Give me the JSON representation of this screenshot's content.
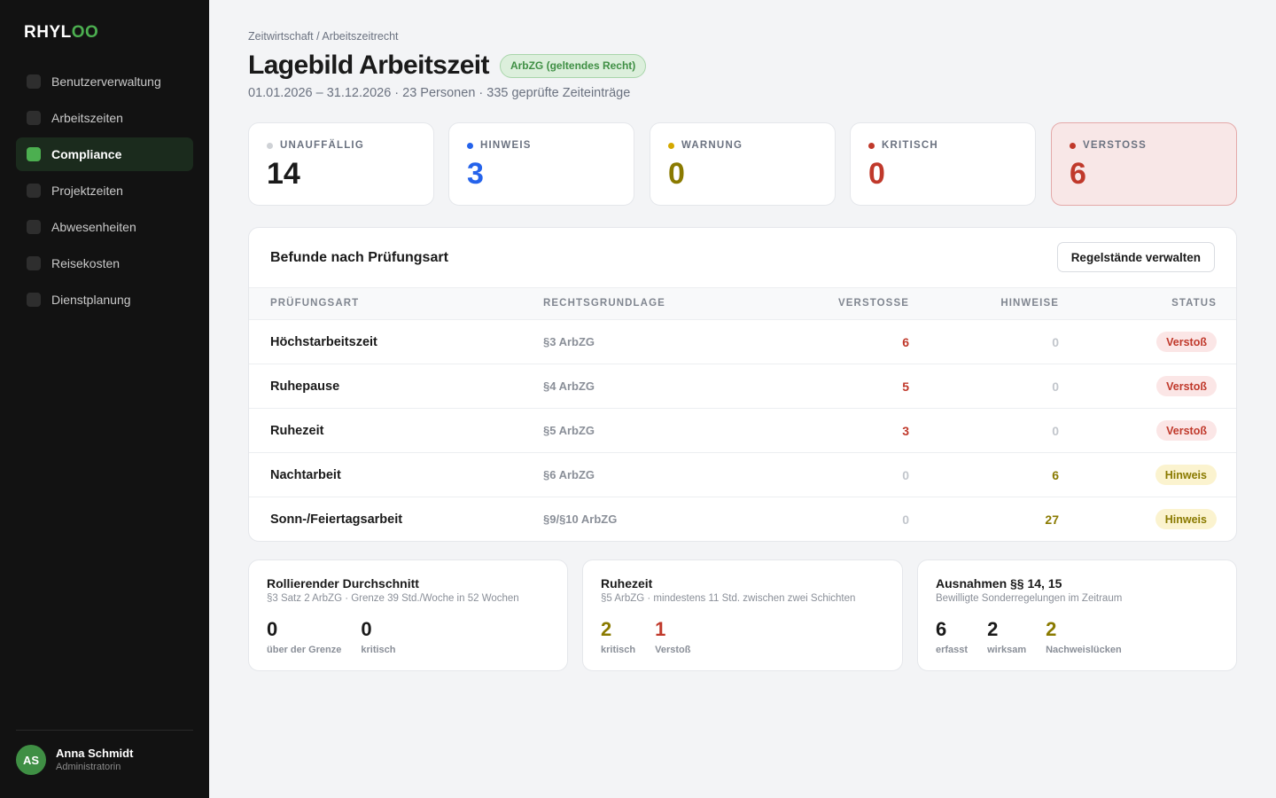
{
  "brand": {
    "logo_main": "RHYL",
    "logo_accent": "OO"
  },
  "sidebar": {
    "items": [
      {
        "label": "Benutzerverwaltung",
        "active": false
      },
      {
        "label": "Arbeitszeiten",
        "active": false
      },
      {
        "label": "Compliance",
        "active": true
      },
      {
        "label": "Projektzeiten",
        "active": false
      },
      {
        "label": "Abwesenheiten",
        "active": false
      },
      {
        "label": "Reisekosten",
        "active": false
      },
      {
        "label": "Dienstplanung",
        "active": false
      }
    ],
    "user": {
      "initials": "AS",
      "name": "Anna Schmidt",
      "role": "Administratorin"
    }
  },
  "header": {
    "breadcrumb": "Zeitwirtschaft / Arbeitszeitrecht",
    "title": "Lagebild Arbeitszeit",
    "badge": "ArbZG (geltendes Recht)",
    "subtitle": "01.01.2026 – 31.12.2026 · 23 Personen · 335 geprüfte Zeiteinträge"
  },
  "stats": [
    {
      "label": "UNAUFFÄLLIG",
      "value": "14",
      "color": "#1a1a1a",
      "dot": "#cfd2d6"
    },
    {
      "label": "HINWEIS",
      "value": "3",
      "color": "#2563eb",
      "dot": "#2563eb"
    },
    {
      "label": "WARNUNG",
      "value": "0",
      "color": "#8a7a00",
      "dot": "#d4a800"
    },
    {
      "label": "KRITISCH",
      "value": "0",
      "color": "#c0392b",
      "dot": "#c0392b"
    },
    {
      "label": "VERSTOSS",
      "value": "6",
      "color": "#c0392b",
      "dot": "#c0392b"
    }
  ],
  "findings": {
    "title": "Befunde nach Prüfungsart",
    "button": "Regelstände verwalten",
    "columns": [
      "PRÜFUNGSART",
      "RECHTSGRUNDLAGE",
      "VERSTOSSE",
      "HINWEISE",
      "STATUS"
    ],
    "rows": [
      {
        "type": "Höchstarbeitszeit",
        "law": "§3 ArbZG",
        "violations": "6",
        "hints": "0",
        "status": "Verstoß"
      },
      {
        "type": "Ruhepause",
        "law": "§4 ArbZG",
        "violations": "5",
        "hints": "0",
        "status": "Verstoß"
      },
      {
        "type": "Ruhezeit",
        "law": "§5 ArbZG",
        "violations": "3",
        "hints": "0",
        "status": "Verstoß"
      },
      {
        "type": "Nachtarbeit",
        "law": "§6 ArbZG",
        "violations": "0",
        "hints": "6",
        "status": "Hinweis"
      },
      {
        "type": "Sonn-/Feiertagsarbeit",
        "law": "§9/§10 ArbZG",
        "violations": "0",
        "hints": "27",
        "status": "Hinweis"
      }
    ]
  },
  "panels": [
    {
      "title": "Rollierender Durchschnitt",
      "subtitle": "§3 Satz 2 ArbZG · Grenze 39 Std./Woche in 52 Wochen",
      "stats": [
        {
          "value": "0",
          "label": "über der Grenze",
          "color": "#1a1a1a"
        },
        {
          "value": "0",
          "label": "kritisch",
          "color": "#1a1a1a"
        }
      ]
    },
    {
      "title": "Ruhezeit",
      "subtitle": "§5 ArbZG · mindestens 11 Std. zwischen zwei Schichten",
      "stats": [
        {
          "value": "2",
          "label": "kritisch",
          "color": "#8a7a00"
        },
        {
          "value": "1",
          "label": "Verstoß",
          "color": "#c0392b"
        }
      ]
    },
    {
      "title": "Ausnahmen §§ 14, 15",
      "subtitle": "Bewilligte Sonderregelungen im Zeitraum",
      "stats": [
        {
          "value": "6",
          "label": "erfasst",
          "color": "#1a1a1a"
        },
        {
          "value": "2",
          "label": "wirksam",
          "color": "#1a1a1a"
        },
        {
          "value": "2",
          "label": "Nachweislücken",
          "color": "#8a7a00"
        }
      ]
    }
  ],
  "colors": {
    "accent": "#4caf50",
    "violation": "#c0392b",
    "hint": "#8a7a00",
    "muted_zero": "#c2c6cc"
  }
}
